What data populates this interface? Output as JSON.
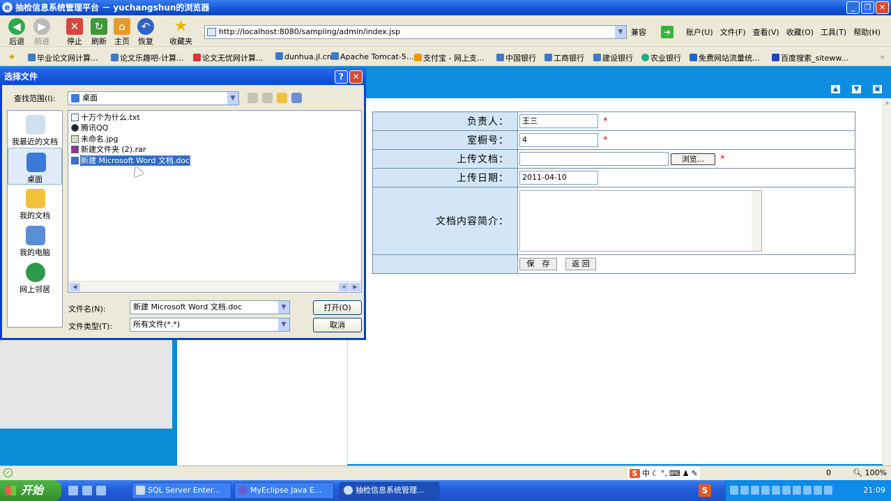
{
  "browser": {
    "title": "抽检信息系统管理平台 － yuchangshun的浏览器",
    "toolbar": {
      "back": "后退",
      "forward": "前进",
      "stop": "停止",
      "refresh": "刷新",
      "home": "主页",
      "restore": "恢复",
      "favorites": "收藏夹"
    },
    "address": "http://localhost:8080/sampling/admin/index.jsp",
    "compat": "兼容",
    "menus": [
      "账户(U)",
      "文件(F)",
      "查看(V)",
      "收藏(O)",
      "工具(T)",
      "帮助(H)"
    ],
    "favorites_bar": [
      "毕业论文网计算...",
      "论文乐趣吧-计算...",
      "论文无忧网计算...",
      "dunhua.jl.cn",
      "Apache Tomcat-5....",
      "支付宝 - 网上支...",
      "中国银行",
      "工商银行",
      "建设银行",
      "农业银行",
      "免费网站流量统...",
      "百度搜索_siteww..."
    ],
    "zoom": "100%"
  },
  "form": {
    "rows": [
      {
        "label": "负责人：",
        "value": "王三",
        "required": "*"
      },
      {
        "label": "室橱号：",
        "value": "4",
        "required": "*"
      },
      {
        "label": "上传文档：",
        "value": "",
        "button": "浏览...",
        "required": "*"
      },
      {
        "label": "上传日期：",
        "value": "2011-04-10"
      },
      {
        "label": "文档内容简介：",
        "value": ""
      }
    ],
    "save": "保　存",
    "back": "返 回"
  },
  "dialog": {
    "title": "选择文件",
    "lookin_label": "查找范围(I):",
    "lookin_value": "桌面",
    "places": [
      "我最近的文档",
      "桌面",
      "我的文档",
      "我的电脑",
      "网上邻居"
    ],
    "files": [
      "十万个为什么.txt",
      "腾讯QQ",
      "未命名.jpg",
      "新建文件夹 (2).rar",
      "新建 Microsoft Word 文档.doc"
    ],
    "filename_label": "文件名(N):",
    "filename_value": "新建 Microsoft Word 文档.doc",
    "filetype_label": "文件类型(T):",
    "filetype_value": "所有文件(*.*)",
    "open": "打开(O)",
    "cancel": "取消"
  },
  "taskbar": {
    "start": "开始",
    "tasks": [
      "SQL Server Enter...",
      "MyEclipse Java E...",
      "抽检信息系统管理..."
    ],
    "clock": "21:09",
    "ime": "中",
    "ime_count": "0"
  },
  "colors": {
    "accent": "#0a8cd6",
    "label_bg": "#d3e6f5",
    "required": "#ee0000"
  }
}
